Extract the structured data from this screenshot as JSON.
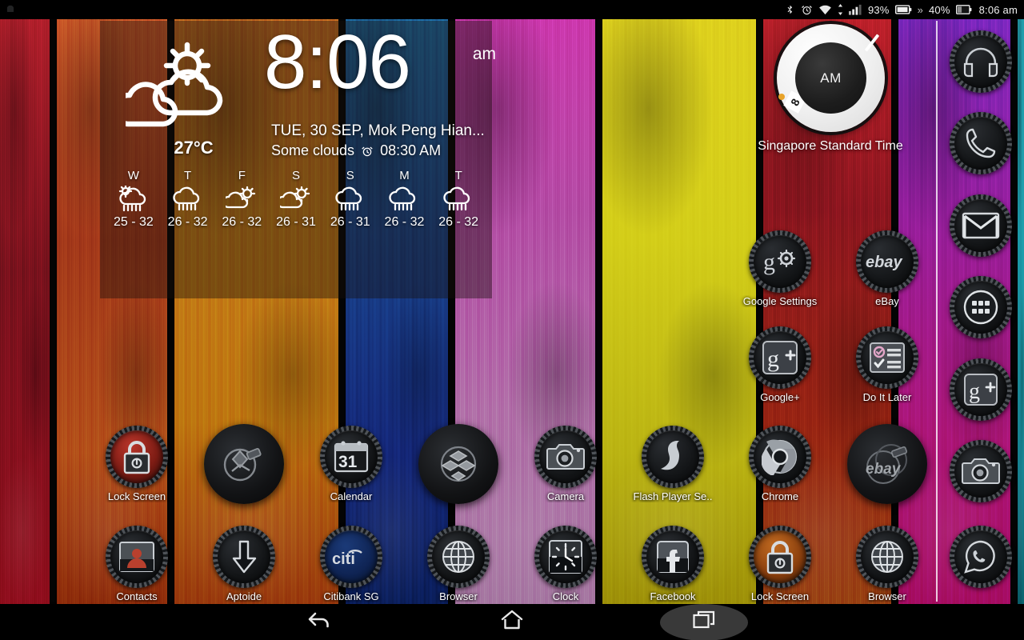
{
  "statusbar": {
    "notification_icon": "android-notification-icon",
    "icons": [
      "bluetooth-icon",
      "alarm-icon",
      "wifi-icon",
      "signal-icon"
    ],
    "battery_percent_1": "93%",
    "battery_icon_1": "battery-empty-icon",
    "separator": "»",
    "battery_percent_2": "40%",
    "battery_icon_2": "battery-partial-icon",
    "clock": "8:06 am"
  },
  "weather_widget": {
    "icon": "sun-behind-clouds-icon",
    "temperature": "27°C",
    "time": "8:06",
    "ampm": "am",
    "date": "TUE, 30 SEP, Mok Peng Hian...",
    "condition": "Some clouds",
    "alarm_icon": "alarm-clock-icon",
    "alarm_time": "08:30 AM",
    "forecast": [
      {
        "day": "W",
        "icon": "sun-cloud-rain-icon",
        "range": "25 - 32"
      },
      {
        "day": "T",
        "icon": "cloud-rain-icon",
        "range": "26 - 32"
      },
      {
        "day": "F",
        "icon": "sun-cloud-icon",
        "range": "26 - 32"
      },
      {
        "day": "S",
        "icon": "sun-cloud-icon",
        "range": "26 - 31"
      },
      {
        "day": "S",
        "icon": "cloud-rain-icon",
        "range": "26 - 31"
      },
      {
        "day": "M",
        "icon": "cloud-rain-icon",
        "range": "26 - 32"
      },
      {
        "day": "T",
        "icon": "cloud-rain-icon",
        "range": "26 - 32"
      }
    ]
  },
  "world_clock_widget": {
    "meridiem": "AM",
    "hour_marker": "8",
    "label": "Singapore Standard Time"
  },
  "right_column_apps": [
    {
      "label": "Google Settings",
      "icon": "google-settings-icon"
    },
    {
      "label": "eBay",
      "icon": "ebay-icon"
    },
    {
      "label": "Google+",
      "icon": "google-plus-icon"
    },
    {
      "label": "Do It Later",
      "icon": "do-it-later-icon"
    }
  ],
  "app_row_1": [
    {
      "label": "Lock Screen",
      "icon": "padlock-icon",
      "style": "gear"
    },
    {
      "label": "",
      "icon": "xperia-blur-icon",
      "style": "blob"
    },
    {
      "label": "Calendar",
      "icon": "calendar-31-icon",
      "style": "gear"
    },
    {
      "label": "",
      "icon": "dropbox-blur-icon",
      "style": "blob"
    },
    {
      "label": "Camera",
      "icon": "camera-icon",
      "style": "gear"
    },
    {
      "label": "Flash Player Se..",
      "icon": "flash-player-icon",
      "style": "gear"
    },
    {
      "label": "Chrome",
      "icon": "chrome-icon",
      "style": "gear"
    },
    {
      "label": "",
      "icon": "ebay-blur-icon",
      "style": "blob"
    }
  ],
  "app_row_2": [
    {
      "label": "Contacts",
      "icon": "contacts-icon",
      "style": "gear"
    },
    {
      "label": "Aptoide",
      "icon": "aptoide-icon",
      "style": "gear"
    },
    {
      "label": "Citibank SG",
      "icon": "citibank-icon",
      "style": "gear"
    },
    {
      "label": "Browser",
      "icon": "globe-icon",
      "style": "gear"
    },
    {
      "label": "Clock",
      "icon": "analog-clock-icon",
      "style": "gear"
    },
    {
      "label": "Facebook",
      "icon": "facebook-icon",
      "style": "gear"
    },
    {
      "label": "Lock Screen",
      "icon": "padlock-icon",
      "style": "gear"
    },
    {
      "label": "Browser",
      "icon": "globe-icon",
      "style": "gear"
    }
  ],
  "dock_apps": [
    {
      "label": "",
      "icon": "headphones-icon"
    },
    {
      "label": "",
      "icon": "phone-icon"
    },
    {
      "label": "",
      "icon": "gmail-icon"
    },
    {
      "label": "",
      "icon": "app-drawer-icon"
    },
    {
      "label": "",
      "icon": "google-plus-icon"
    },
    {
      "label": "",
      "icon": "camera-icon"
    },
    {
      "label": "",
      "icon": "whatsapp-icon"
    }
  ],
  "navbar": {
    "back": "back-icon",
    "home": "home-icon",
    "recents": "recents-icon",
    "active": "recents"
  },
  "wallpaper": {
    "description": "multicolor painted wood planks",
    "plank_colors": [
      "#c8122a",
      "#d4531a",
      "#e08a12",
      "#1440a8",
      "#c246b6",
      "#e8e014",
      "#c81424",
      "#d6179a",
      "#16b0bf"
    ]
  }
}
